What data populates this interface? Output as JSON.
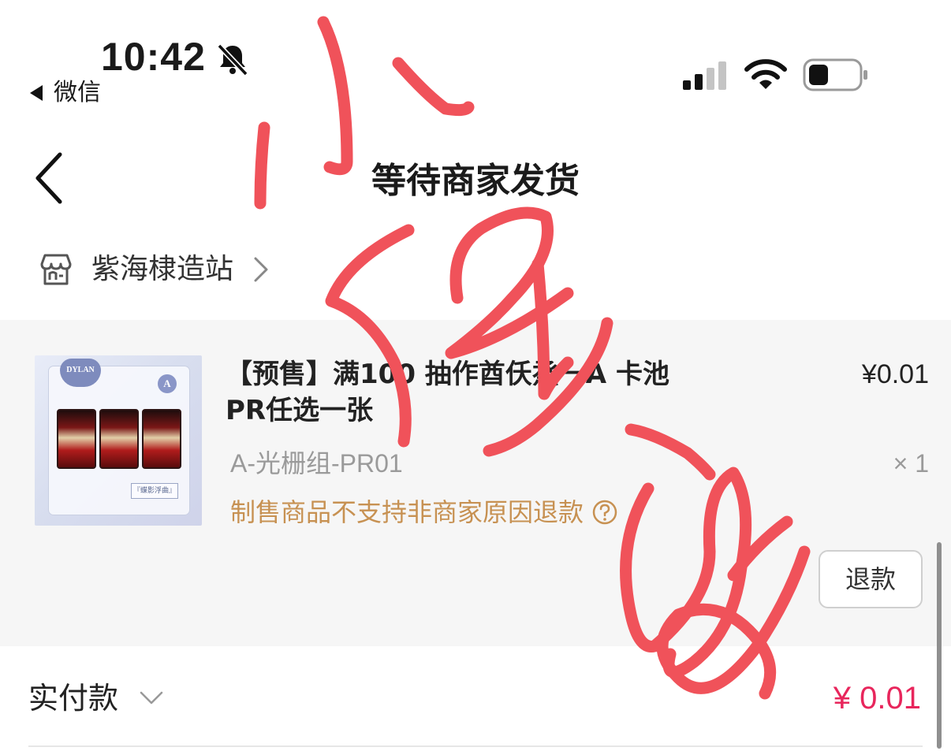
{
  "status_bar": {
    "time": "10:42",
    "back_app_label": "微信",
    "icons": [
      "bell-slash-icon",
      "cellular-signal-icon",
      "wifi-icon",
      "battery-icon"
    ]
  },
  "nav": {
    "title": "等待商家发货"
  },
  "shop": {
    "name": "紫海棣造站"
  },
  "item": {
    "title_line1": "【预售】满100 抽作酋仸烝一A 卡池",
    "title_line2": " PR任选一张",
    "price": "¥0.01",
    "spec": "A-光栅组-PR01",
    "quantity": "× 1",
    "notice": "制售商品不支持非商家原因退款",
    "refund_button": "退款",
    "thumbnail": {
      "heart_text": "DYLAN",
      "badge": "A",
      "tag": "『蝶影浮曲』"
    }
  },
  "payment": {
    "label": "实付款",
    "amount": "¥ 0.01"
  },
  "colors": {
    "accent_price": "#e8265c",
    "notice": "#c79152",
    "card_bg": "#f6f6f6",
    "scribble": "#f0525a"
  }
}
